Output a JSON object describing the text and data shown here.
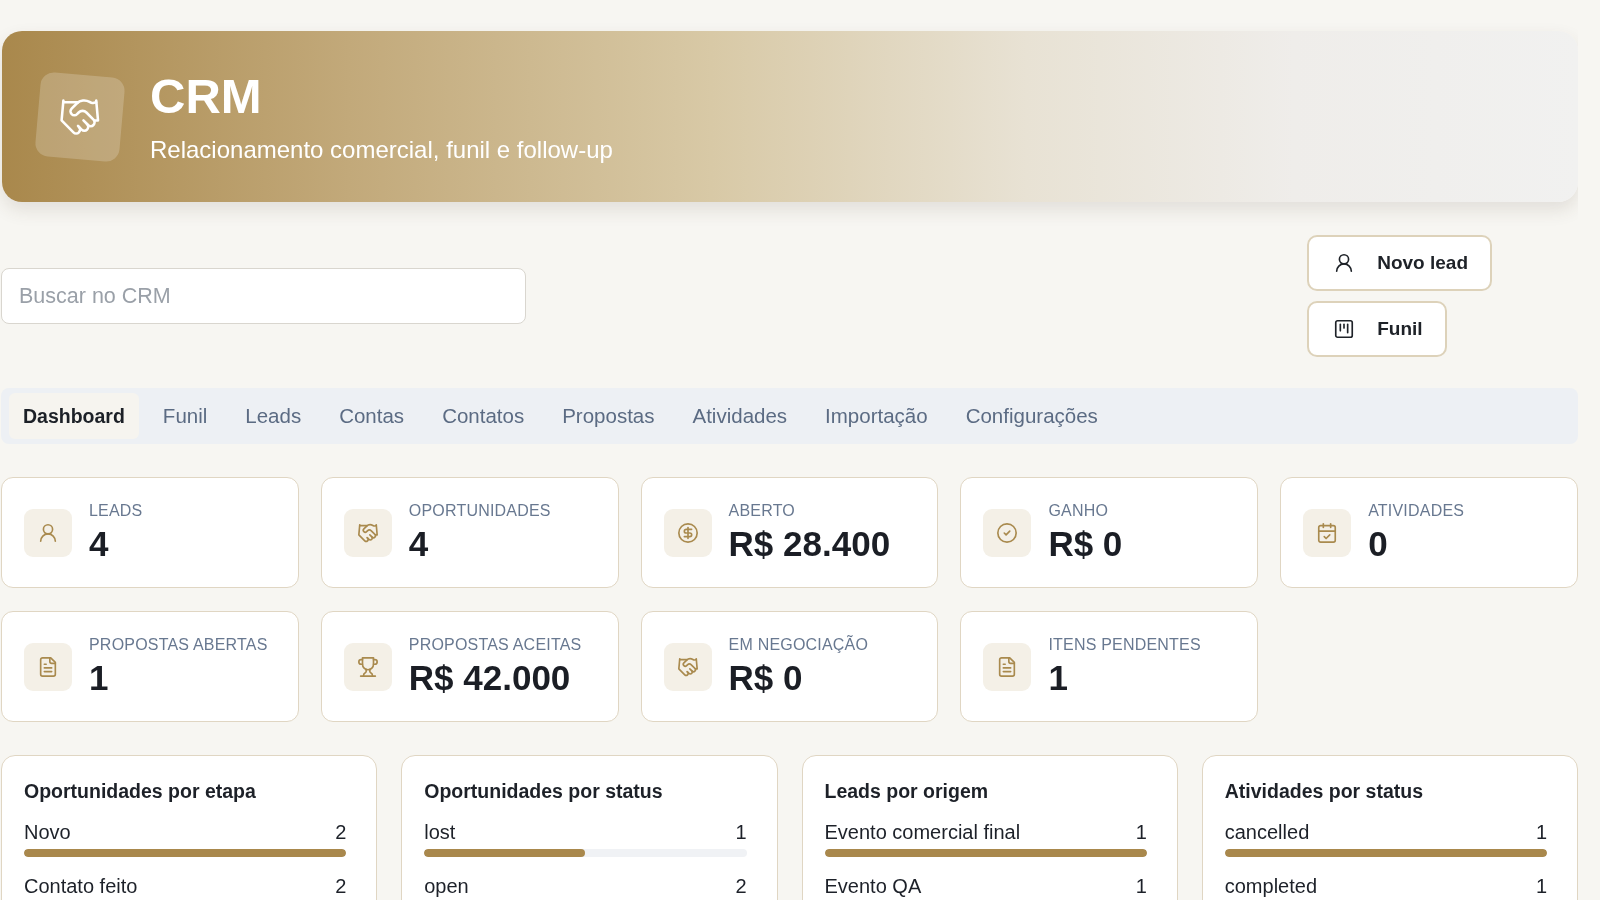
{
  "header": {
    "title": "CRM",
    "subtitle": "Relacionamento comercial, funil e follow-up"
  },
  "search": {
    "placeholder": "Buscar no CRM"
  },
  "actions": [
    {
      "label": "Novo lead"
    },
    {
      "label": "Funil"
    }
  ],
  "tabs": [
    {
      "label": "Dashboard",
      "selected": true
    },
    {
      "label": "Funil",
      "selected": false
    },
    {
      "label": "Leads",
      "selected": false
    },
    {
      "label": "Contas",
      "selected": false
    },
    {
      "label": "Contatos",
      "selected": false
    },
    {
      "label": "Propostas",
      "selected": false
    },
    {
      "label": "Atividades",
      "selected": false
    },
    {
      "label": "Importação",
      "selected": false
    },
    {
      "label": "Configurações",
      "selected": false
    }
  ],
  "stats": [
    {
      "label": "LEADS",
      "value": "4"
    },
    {
      "label": "OPORTUNIDADES",
      "value": "4"
    },
    {
      "label": "ABERTO",
      "value": "R$ 28.400"
    },
    {
      "label": "GANHO",
      "value": "R$ 0"
    },
    {
      "label": "ATIVIDADES",
      "value": "0"
    },
    {
      "label": "PROPOSTAS ABERTAS",
      "value": "1"
    },
    {
      "label": "PROPOSTAS ACEITAS",
      "value": "R$ 42.000"
    },
    {
      "label": "EM NEGOCIAÇÃO",
      "value": "R$ 0"
    },
    {
      "label": "ITENS PENDENTES",
      "value": "1"
    }
  ],
  "panels": [
    {
      "title": "Oportunidades por etapa",
      "rows": [
        {
          "label": "Novo",
          "count": "2",
          "level": 1
        },
        {
          "label": "Contato feito",
          "count": "2"
        }
      ]
    },
    {
      "title": "Oportunidades por status",
      "rows": [
        {
          "label": "lost",
          "count": "1",
          "level": 0.5
        },
        {
          "label": "open",
          "count": "2"
        }
      ]
    },
    {
      "title": "Leads por origem",
      "rows": [
        {
          "label": "Evento comercial final",
          "count": "1",
          "level": 1
        },
        {
          "label": "Evento QA",
          "count": "1"
        }
      ]
    },
    {
      "title": "Atividades por status",
      "rows": [
        {
          "label": "cancelled",
          "count": "1",
          "level": 1
        },
        {
          "label": "completed",
          "count": "1"
        }
      ]
    }
  ]
}
